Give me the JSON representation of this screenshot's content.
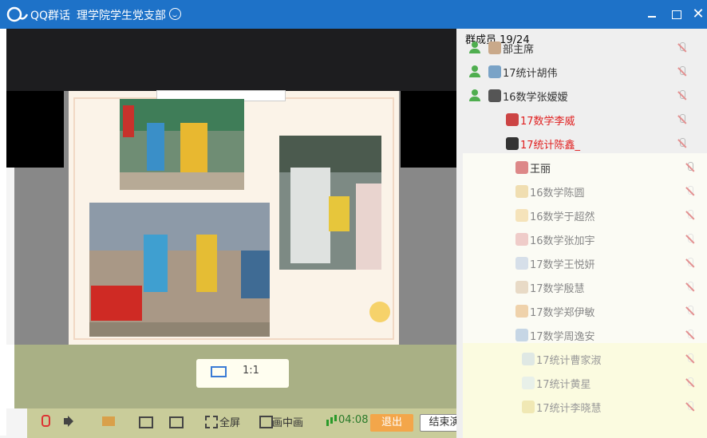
{
  "window": {
    "app_name": "QQ群话",
    "group_name": "理学院学生党支部"
  },
  "slide": {
    "caption": "",
    "ratio_label": "1:1"
  },
  "toolbar": {
    "fullscreen_label": "全屏",
    "pip_label": "画中画",
    "duration": "04:08",
    "exit_label": "退出",
    "end_label": "结束演"
  },
  "panel": {
    "title": "群成员 19/24",
    "members": [
      {
        "name": "部主席",
        "color": "#333333"
      },
      {
        "name": "17统计胡伟",
        "color": "#333333"
      },
      {
        "name": "16数学张嫒嫒",
        "color": "#333333"
      },
      {
        "name": "17数学李威",
        "color": "#e02020"
      },
      {
        "name": "17统计陈鑫_",
        "color": "#e02020"
      },
      {
        "name": "王丽",
        "color": "#333333"
      },
      {
        "name": "16数学陈圆",
        "color": "#888888"
      },
      {
        "name": "16数学于超然",
        "color": "#888888"
      },
      {
        "name": "16数学张加宇",
        "color": "#888888"
      },
      {
        "name": "17数学王悦妍",
        "color": "#888888"
      },
      {
        "name": "17数学殷慧",
        "color": "#888888"
      },
      {
        "name": "17数学郑伊敏",
        "color": "#888888"
      },
      {
        "name": "17数学周逸安",
        "color": "#888888"
      },
      {
        "name": "17统计曹家淑",
        "color": "#999999"
      },
      {
        "name": "17统计黄星",
        "color": "#999999"
      },
      {
        "name": "17统计李晓慧",
        "color": "#999999"
      }
    ]
  }
}
